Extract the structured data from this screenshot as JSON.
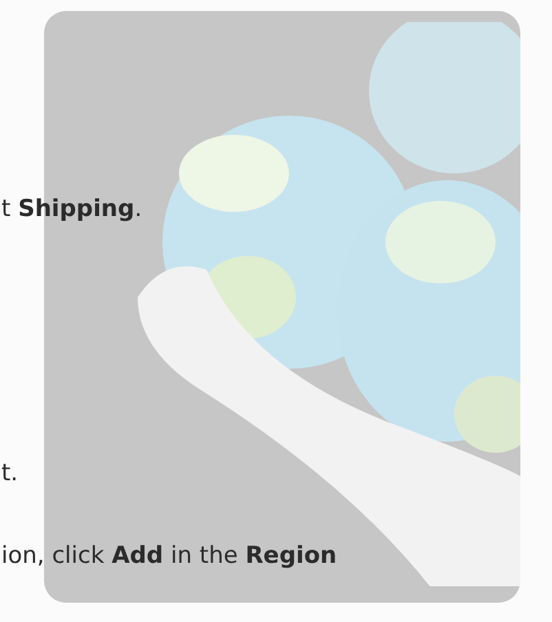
{
  "lines": [
    {
      "text": "t **Shipping**."
    },
    {
      "text": "t."
    },
    {
      "text": "ion, click **Add** in the **Region**"
    }
  ]
}
